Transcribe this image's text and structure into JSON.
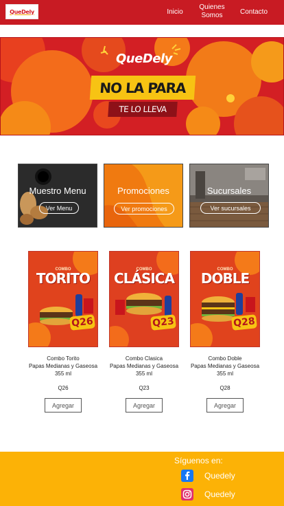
{
  "header": {
    "logo_text": "QueDely",
    "nav": [
      {
        "label": "Inicio"
      },
      {
        "label": "Quienes Somos"
      },
      {
        "label": "Contacto"
      }
    ]
  },
  "hero": {
    "logo_text": "QueDely",
    "headline": "NO LA PARA",
    "subline": "TE LO LLEVA"
  },
  "categories": [
    {
      "title": "Muestro Menu",
      "button": "Ver Menu"
    },
    {
      "title": "Promociones",
      "button": "Ver promociones"
    },
    {
      "title": "Sucursales",
      "button": "Ver sucursales"
    }
  ],
  "products": [
    {
      "banner_small": "COMBO",
      "banner": "TORITO",
      "tag": "Q26",
      "name": "Combo Torito",
      "desc": "Papas Medianas y Gaseosa",
      "size": "355 ml",
      "price": "Q26",
      "button": "Agregar"
    },
    {
      "banner_small": "COMBO",
      "banner": "CLÁSICA",
      "tag": "Q23",
      "name": "Combo Clasica",
      "desc": "Papas Medianas y Gaseosa",
      "size": "355 ml",
      "price": "Q23",
      "button": "Agregar"
    },
    {
      "banner_small": "COMBO",
      "banner": "DOBLE",
      "tag": "Q28",
      "name": "Combo Doble",
      "desc": "Papas Medianas y Gaseosa",
      "size": "355 ml",
      "price": "Q28",
      "button": "Agregar"
    }
  ],
  "footer": {
    "follow": "Síguenos en:",
    "social": [
      {
        "icon": "facebook-icon",
        "label": "Quedely"
      },
      {
        "icon": "instagram-icon",
        "label": "Quedely"
      }
    ]
  },
  "colors": {
    "header_red": "#c81b23",
    "hero_red": "#d31f24",
    "hero_orange": "#f58a17",
    "brand_yellow": "#f7c313",
    "footer_yellow": "#fcb206"
  }
}
